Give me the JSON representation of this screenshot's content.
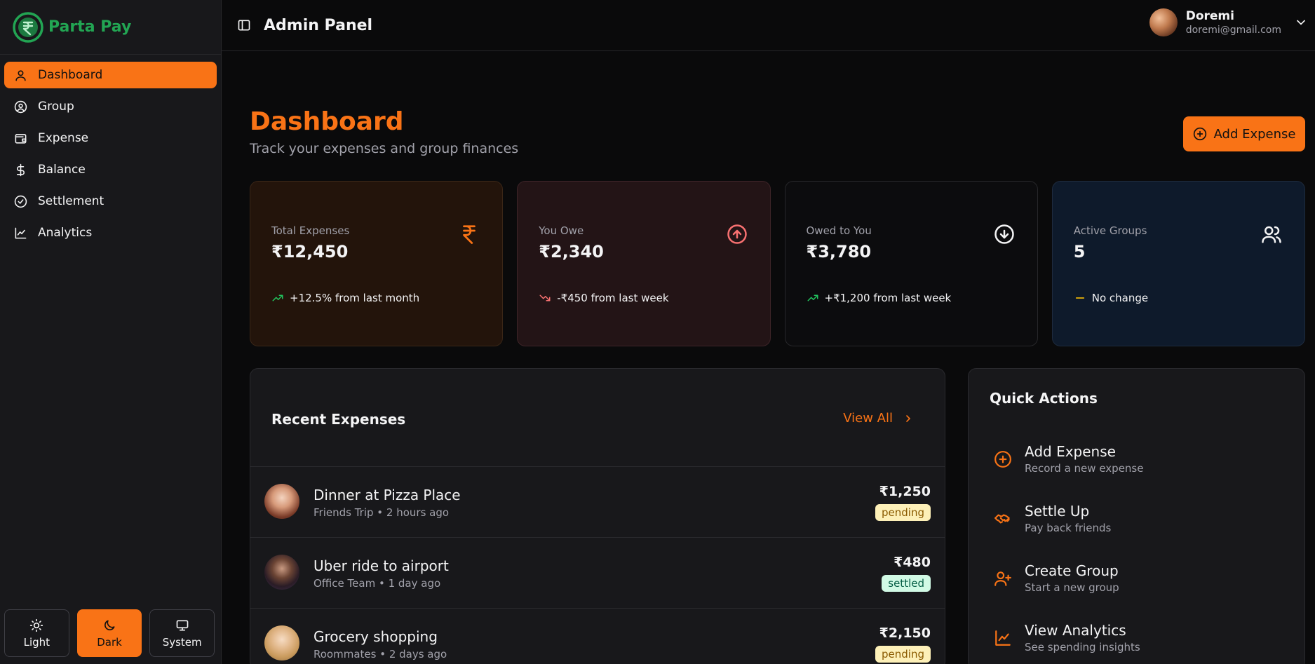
{
  "brand": {
    "name": "Parta Pay"
  },
  "sidebar": {
    "items": [
      {
        "label": "Dashboard",
        "icon": "user-icon",
        "active": true
      },
      {
        "label": "Group",
        "icon": "user-circle-icon"
      },
      {
        "label": "Expense",
        "icon": "wallet-icon"
      },
      {
        "label": "Balance",
        "icon": "dollar-icon"
      },
      {
        "label": "Settlement",
        "icon": "check-circle-icon"
      },
      {
        "label": "Analytics",
        "icon": "line-chart-icon"
      }
    ],
    "theme": {
      "light": "Light",
      "dark": "Dark",
      "system": "System",
      "selected": "Dark"
    }
  },
  "header": {
    "title": "Admin Panel"
  },
  "user": {
    "name": "Doremi",
    "email": "doremi@gmail.com"
  },
  "page": {
    "title": "Dashboard",
    "subtitle": "Track your expenses and group finances",
    "add_button": "Add Expense"
  },
  "stats": [
    {
      "label": "Total Expenses",
      "value": "₹12,450",
      "change": "+12.5% from last month",
      "icon": "rupee-icon",
      "trend": "up"
    },
    {
      "label": "You Owe",
      "value": "₹2,340",
      "change": "-₹450 from last week",
      "icon": "arrow-up-circle-icon",
      "trend": "down"
    },
    {
      "label": "Owed to You",
      "value": "₹3,780",
      "change": "+₹1,200 from last week",
      "icon": "arrow-down-circle-icon",
      "trend": "up"
    },
    {
      "label": "Active Groups",
      "value": "5",
      "change": "No change",
      "icon": "users-icon",
      "trend": "flat"
    }
  ],
  "recent": {
    "title": "Recent Expenses",
    "view_all": "View All",
    "rows": [
      {
        "title": "Dinner at Pizza Place",
        "meta": "Friends Trip • 2 hours ago",
        "amount": "₹1,250",
        "status": "pending"
      },
      {
        "title": "Uber ride to airport",
        "meta": "Office Team • 1 day ago",
        "amount": "₹480",
        "status": "settled"
      },
      {
        "title": "Grocery shopping",
        "meta": "Roommates • 2 days ago",
        "amount": "₹2,150",
        "status": "pending"
      }
    ]
  },
  "quick": {
    "title": "Quick Actions",
    "actions": [
      {
        "title": "Add Expense",
        "sub": "Record a new expense",
        "icon": "plus-circle-icon"
      },
      {
        "title": "Settle Up",
        "sub": "Pay back friends",
        "icon": "handshake-icon"
      },
      {
        "title": "Create Group",
        "sub": "Start a new group",
        "icon": "user-plus-icon"
      },
      {
        "title": "View Analytics",
        "sub": "See spending insights",
        "icon": "line-chart-icon"
      }
    ]
  },
  "colors": {
    "accent": "#f97316",
    "brand": "#22a553",
    "trend_up": "#22c55e",
    "trend_down": "#f87171",
    "flat": "#eab308"
  }
}
